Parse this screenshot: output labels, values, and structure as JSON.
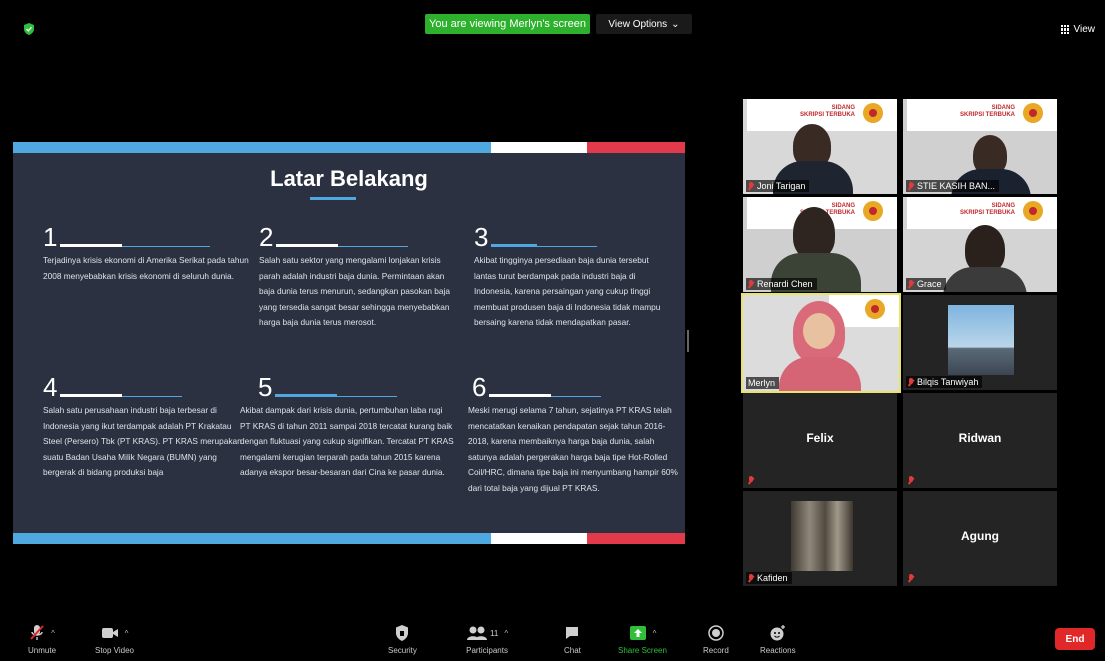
{
  "topbar": {
    "viewing_banner": "You are viewing Merlyn's screen",
    "view_options": "View Options",
    "view_label": "View"
  },
  "slide": {
    "title": "Latar Belakang",
    "points": [
      {
        "num": "1",
        "bar_color": "#ffffff",
        "text": "Terjadinya krisis ekonomi di Amerika Serikat pada tahun 2008 menyebabkan krisis ekonomi di seluruh dunia."
      },
      {
        "num": "2",
        "bar_color": "#ffffff",
        "text": "Salah satu sektor yang mengalami lonjakan krisis parah adalah industri baja dunia. Permintaan akan baja dunia terus menurun, sedangkan pasokan baja yang tersedia sangat besar sehingga menyebabkan harga baja dunia terus merosot."
      },
      {
        "num": "3",
        "bar_color": "#4fa8e0",
        "text": "Akibat tingginya persediaan baja dunia tersebut lantas turut berdampak pada industri baja di Indonesia, karena persaingan yang cukup tinggi membuat produsen baja di Indonesia tidak mampu bersaing karena tidak mendapatkan pasar."
      },
      {
        "num": "4",
        "bar_color": "#ffffff",
        "text": "Salah satu perusahaan industri baja terbesar di Indonesia yang ikut terdampak adalah PT Krakatau Steel (Persero) Tbk (PT KRAS). PT KRAS merupakan suatu Badan Usaha Milik Negara (BUMN) yang bergerak di bidang produksi baja"
      },
      {
        "num": "5",
        "bar_color": "#4fa8e0",
        "text": "Akibat dampak dari krisis dunia, pertumbuhan laba rugi PT KRAS di tahun 2011 sampai 2018 tercatat kurang baik dengan fluktuasi yang cukup signifikan. Tercatat PT KRAS mengalami kerugian terparah pada tahun 2015 karena adanya ekspor besar-besaran dari Cina ke pasar dunia."
      },
      {
        "num": "6",
        "bar_color": "#ffffff",
        "text": "Meski merugi selama 7 tahun, sejatinya PT KRAS telah mencatatkan kenaikan pendapatan sejak tahun 2016-2018, karena membaiknya harga baja dunia, salah satunya adalah pergerakan harga baja tipe Hot-Rolled Coil/HRC, dimana tipe baja ini menyumbang hampir 60% dari total baja yang dijual PT KRAS."
      }
    ]
  },
  "participants": [
    {
      "name": "Joni Tarigan",
      "sidang": "SIDANG\nSKRIPSI TERBUKA"
    },
    {
      "name": "STIE KASIH BAN...",
      "sidang": "SIDANG\nSKRIPSI TERBUKA"
    },
    {
      "name": "Renardi Chen",
      "sidang": "SIDANG\nSKRIPSI TERBUKA"
    },
    {
      "name": "Grace",
      "sidang": "SIDANG\nSKRIPSI TERBUKA"
    },
    {
      "name": "Merlyn"
    },
    {
      "name": "Bilqis Tanwiyah"
    },
    {
      "name": "Felix"
    },
    {
      "name": "Ridwan"
    },
    {
      "name": "Kafiden"
    },
    {
      "name": "Agung"
    }
  ],
  "toolbar": {
    "unmute": "Unmute",
    "stop_video": "Stop Video",
    "security": "Security",
    "participants": "Participants",
    "participants_count": "11",
    "chat": "Chat",
    "share_screen": "Share Screen",
    "record": "Record",
    "reactions": "Reactions",
    "end": "End"
  },
  "colors": {
    "banner_green": "#2db12d",
    "end_red": "#e02828",
    "slide_bg": "#2b3140",
    "stripe_blue": "#4fa8e0",
    "stripe_red": "#e23a4b",
    "active_speaker": "#e8e36b"
  }
}
